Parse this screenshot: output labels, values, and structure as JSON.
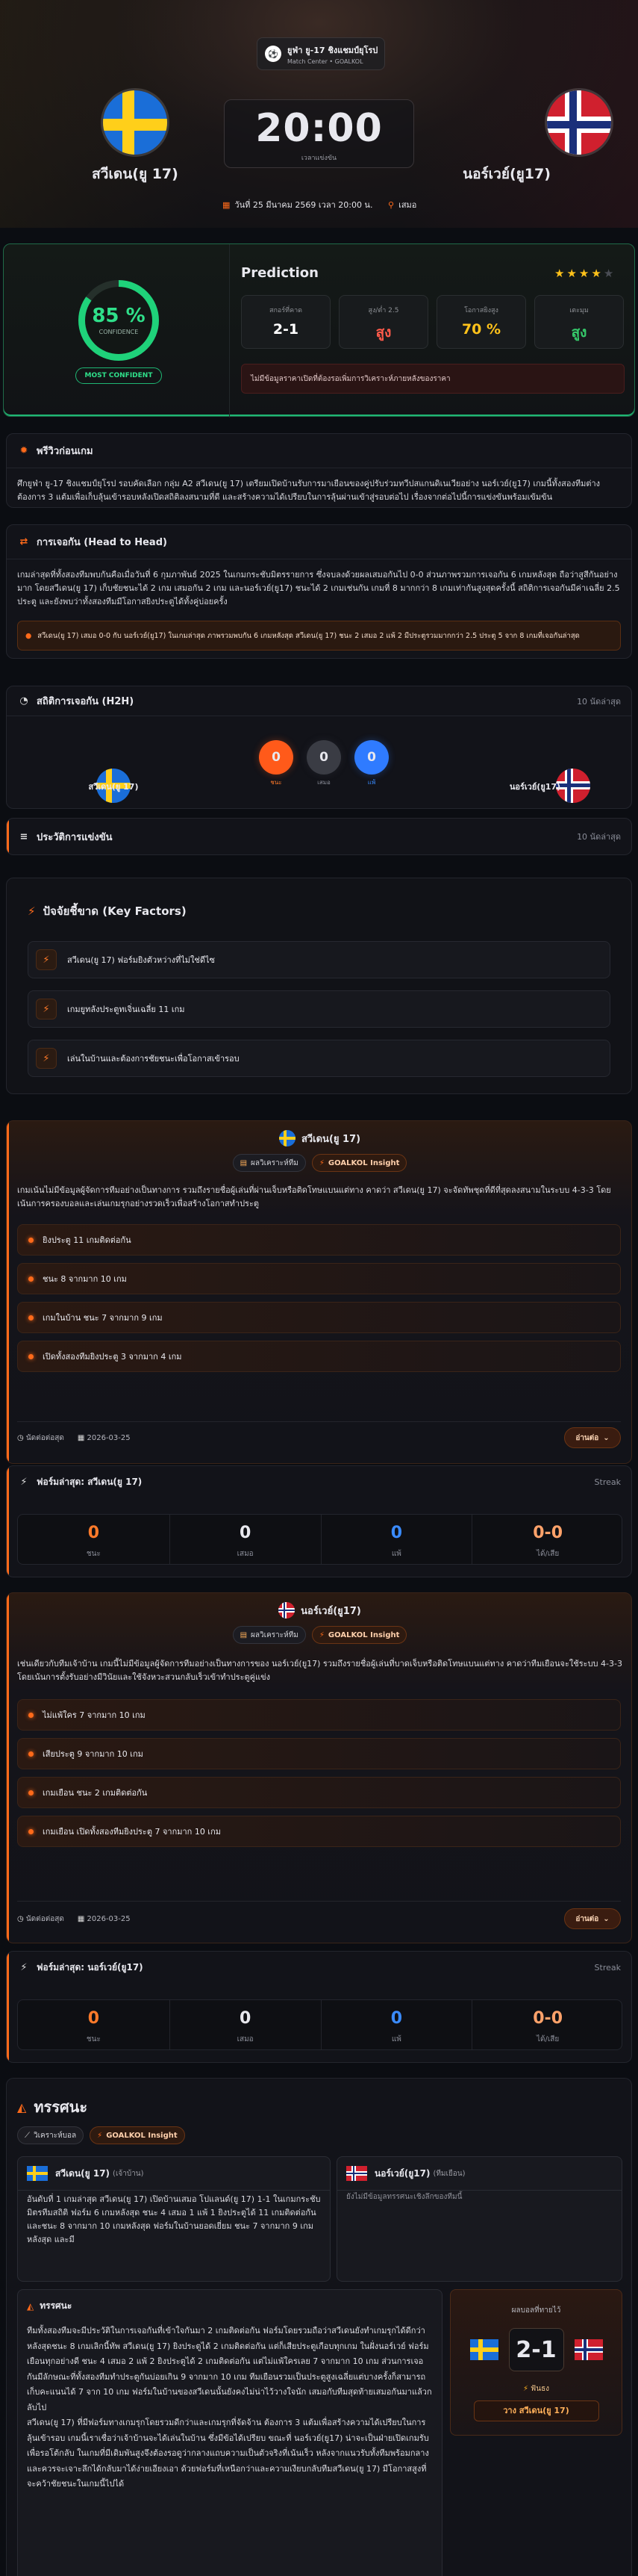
{
  "header": {
    "league": "ยูฟ่า ยู-17 ชิงแชมป์ยุโรป",
    "subtitle": "Match Center • GOALKOL",
    "home_team": "สวีเดน(ยู 17)",
    "away_team": "นอร์เวย์(ยู17)",
    "kickoff_time": "20:00",
    "kickoff_caption": "เวลาแข่งขัน",
    "date": "วันที่ 25 มีนาคม 2569 เวลา 20:00 น.",
    "venue": "เสมอ"
  },
  "prediction": {
    "title": "Prediction",
    "confidence": "85 %",
    "confidence_label": "CONFIDENCE",
    "badge": "MOST CONFIDENT",
    "stars": 4,
    "cells": [
      {
        "label": "สกอร์ที่คาด",
        "value": "2-1",
        "color": "#ffffff"
      },
      {
        "label": "สูง/ต่ำ 2.5",
        "value": "สูง",
        "color": "#ff5a4a"
      },
      {
        "label": "โอกาสยิงสูง",
        "value": "70 %",
        "color": "#ffc21a"
      },
      {
        "label": "เตะมุม",
        "value": "สูง",
        "color": "#35c96a"
      }
    ],
    "note": "ไม่มีข้อมูลราคาเปิดที่ต้องรอเพิ่มการวิเคราะห์ภายหลังของราคา"
  },
  "preview": {
    "title": "พรีวิวก่อนเกม",
    "text": "ศึกยูฟ่า ยู-17 ชิงแชมป์ยุโรป รอบคัดเลือก กลุ่ม A2 สวีเดน(ยู 17) เตรียมเปิดบ้านรับการมาเยือนของคู่ปรับร่วมทวีปสแกนดิเนเวียอย่าง นอร์เวย์(ยู17) เกมนี้ทั้งสองทีมต่างต้องการ 3 แต้มเพื่อเก็บลุ้นเข้ารอบหลังเปิดสถิติลงสนามที่ดี และสร้างความได้เปรียบในการลุ้นผ่านเข้าสู่รอบต่อไป เรื่องจากต่อไปนี้การแข่งขันพร้อมเข้มข้น"
  },
  "h2h_text": {
    "title": "การเจอกัน (Head to Head)",
    "text": "เกมล่าสุดที่ทั้งสองทีมพบกันคือเมื่อวันที่ 6 กุมภาพันธ์ 2025 ในเกมกระชับมิตรรายการ ซึ่งจบลงด้วยผลเสมอกันไป 0-0 ส่วนภาพรวมการเจอกัน 6 เกมหลังสุด ถือว่าสูสีกันอย่างมาก โดยสวีเดน(ยู 17) เก็บชัยชนะได้ 2 เกม เสมอกัน 2 เกม และนอร์เวย์(ยู17) ชนะได้ 2 เกมเช่นกัน เกมที่ 8 มากกว่า 8 เกมเท่ากันสูงสุดครั้งนี้ สถิติการเจอกันมีค่าเฉลี่ย 2.5 ประตู และยังพบว่าทั้งสองทีมมีโอกาสยิงประตูได้ทั้งคู่บ่อยครั้ง",
    "highlight": "สวีเดน(ยู 17) เสมอ 0-0 กับ นอร์เวย์(ยู17) ในเกมล่าสุด ภาพรวมพบกัน 6 เกมหลังสุด สวีเดน(ยู 17) ชนะ 2 เสมอ 2 แพ้ 2 มีประตูรวมมากกว่า 2.5 ประตู 5 จาก 8 เกมที่เจอกันล่าสุด"
  },
  "h2h_stats": {
    "title": "สถิติการเจอกัน (H2H)",
    "right": "10 นัดล่าสุด",
    "home": "สวีเดน(ยู 17)",
    "away": "นอร์เวย์(ยู17)",
    "circles": [
      {
        "value": "0",
        "label": "ชนะ",
        "color": "#ff5a1a"
      },
      {
        "value": "0",
        "label": "เสมอ",
        "color": "#3a3c44"
      },
      {
        "value": "0",
        "label": "แพ้",
        "color": "#2f7bff"
      }
    ]
  },
  "history": {
    "title": "ประวัติการแข่งขัน",
    "right": "10 นัดล่าสุด"
  },
  "key_factors": {
    "title": "ปัจจัยชี้ขาด (Key Factors)",
    "items": [
      "สวีเดน(ยู 17) ฟอร์มยิงตัวหว่างที่ไม่ใช่ดีไซ",
      "เกมยูทลังประตูทเจิ่นเฉลี่ย 11 เกม",
      "เล่นในบ้านและต้องการชัยชนะเพื่อโอกาสเข้ารอบ"
    ]
  },
  "home_insight": {
    "team": "สวีเดน(ยู 17)",
    "tag1": "ผลวิเคราะห์ทีม",
    "tag2": "GOALKOL Insight",
    "text": "เกมเน้นไม่มีข้อมูลผู้จัดการทีมอย่างเป็นทางการ รวมถึงรายชื่อผู้เล่นที่ผ่านเจ็บหรือติดโทษแบนแต่ทาง คาดว่า สวีเดน(ยู 17) จะจัดทัพชุดที่ดีที่สุดลงสนามในระบบ 4-3-3 โดยเน้นการครองบอลและเล่นเกมรุกอย่างรวดเร็วเพื่อสร้างโอกาสทำประตู",
    "bullets": [
      "ยิงประตู 11 เกมติดต่อกัน",
      "ชนะ 8 จากมาก 10 เกม",
      "เกมในบ้าน ชนะ 7 จากมาก 9 เกม",
      "เปิดทั้งสองทีมยิงประตู 3 จากมาก 4 เกม"
    ],
    "meta1": "นัดต่อต่อสุด",
    "meta2": "2026-03-25",
    "more": "อ่านต่อ"
  },
  "home_form": {
    "title": "ฟอร์มล่าสุด: สวีเดน(ยู 17)",
    "right": "Streak",
    "cells": [
      {
        "value": "0",
        "label": "ชนะ",
        "color": "#ff7a2a"
      },
      {
        "value": "0",
        "label": "เสมอ",
        "color": "#e8e8ee"
      },
      {
        "value": "0",
        "label": "แพ้",
        "color": "#3a8bff"
      },
      {
        "value": "0-0",
        "label": "ได้/เสีย",
        "color": "#ffa26a"
      }
    ]
  },
  "away_insight": {
    "team": "นอร์เวย์(ยู17)",
    "tag1": "ผลวิเคราะห์ทีม",
    "tag2": "GOALKOL Insight",
    "text": "เช่นเดียวกับทีมเจ้าบ้าน เกมนี้ไม่มีข้อมูลผู้จัดการทีมอย่างเป็นทางการของ นอร์เวย์(ยู17) รวมถึงรายชื่อผู้เล่นที่บาดเจ็บหรือติดโทษแบนแต่ทาง คาดว่าทีมเยือนจะใช้ระบบ 4-3-3 โดยเน้นการตั้งรับอย่างมีวินัยและใช้จังหวะสวนกลับเร็วเข้าทำประตูคู่แข่ง",
    "bullets": [
      "ไม่แพ้ใคร 7 จากมาก 10 เกม",
      "เสียประตู 9 จากมาก 10 เกม",
      "เกมเยือน ชนะ 2 เกมติดต่อกัน",
      "เกมเยือน เปิดทั้งสองทีมยิงประตู 7 จากมาก 10 เกม"
    ],
    "meta1": "นัดต่อต่อสุด",
    "meta2": "2026-03-25",
    "more": "อ่านต่อ"
  },
  "away_form": {
    "title": "ฟอร์มล่าสุด: นอร์เวย์(ยู17)",
    "right": "Streak",
    "cells": [
      {
        "value": "0",
        "label": "ชนะ",
        "color": "#ff7a2a"
      },
      {
        "value": "0",
        "label": "เสมอ",
        "color": "#e8e8ee"
      },
      {
        "value": "0",
        "label": "แพ้",
        "color": "#3a8bff"
      },
      {
        "value": "0-0",
        "label": "ได้/เสีย",
        "color": "#ffa26a"
      }
    ]
  },
  "analysis": {
    "title": "ทรรศนะ",
    "tag1": "วิเคราะห์บอล",
    "tag2": "GOALKOL Insight",
    "home_card_title": "สวีเดน(ยู 17)",
    "home_card_sub": "(เจ้าบ้าน)",
    "home_card_text": "อันดับที่ 1 เกมล่าสุด สวีเดน(ยู 17) เปิดบ้านเสมอ โปแลนด์(ยู 17) 1-1 ในเกมกระชับมิตรทีมสถิติ ฟอร์ม 6 เกมหลังสุด ชนะ 4 เสมอ 1 แพ้ 1 ยิงประตูได้ 11 เกมติดต่อกัน และชนะ 8 จากมาก 10 เกมหลังสุด ฟอร์มในบ้านยอดเยี่ยม ชนะ 7 จากมาก 9 เกมหลังสุด และมี",
    "away_card_title": "นอร์เวย์(ยู17)",
    "away_card_sub": "(ทีมเยือน)",
    "away_card_text": "ยังไม่มีข้อมูลทรรศนะเชิงลึกของทีมนี้",
    "verdict_title": "ทรรศนะ",
    "verdict_text": "ทีมทั้งสองทีมจะมีประวัติในการเจอกันที่เข้าใจกันมา 2 เกมติดต่อกัน ฟอร์มโดยรวมถือว่าสวีเดนยังทำเกมรุกได้ดีกว่าหลังสุดชนะ 8 เกมเลิกนี้ทัพ สวีเดน(ยู 17) ยิงประตูได้ 2 เกมติดต่อกัน แต่ก็เสียประตูเกือบทุกเกม ในฝั่งนอร์เวย์ ฟอร์มเยือนทุกอย่างดี ชนะ 4 เสมอ 2 แพ้ 2 ยิงประตูได้ 2 เกมติดต่อกัน แต่ไม่แพ้ใครเลย 7 จากมาก 10 เกม ส่วนการเจอกันมีลักษณะที่ทั้งสองทีมทำประตูกันบ่อยเกิน 9 จากมาก 10 เกม ทีมเยือนรวมเป็นประตูสูงเฉลี่ยแต่บางครั้งก็สามารถเก็บคะแนนได้ 7 จาก 10 เกม ฟอร์มในบ้านของสวีเดนนั้นยังคงไม่น่าไว้วางใจนัก เสมอกับทีมสุดท้ายเสมอกันมาแล้วกลับไป\nสวีเดน(ยู 17) ที่มีฟอร์มทางเกมรุกโดยรวมดีกว่าและเกมรุกที่จัดจ้าน ต้องการ 3 แต้มเพื่อสร้างความได้เปรียบในการลุ้นเข้ารอบ เกมนี้เราเชื่อว่าเจ้าบ้านจะได้เล่นในบ้าน ซึ่งมีข้อได้เปรียบ ขณะที่ นอร์เวย์(ยู17) น่าจะเป็นฝ่ายเปิดเกมรับเพื่อรอโต้กลับ ในเกมที่มีเดิมพันสูงจึงต้องรอดูว่ากลางแถบความเป็นตัวจริงที่เน้นเร็ว หลังจากแนวรับทั้งทีมพร้อมกลางและควรจะเจาะลึกได้กลับมาได้ง่ายเอียงเอา ด้วยฟอร์มที่เหนือกว่าและความเงียบกลับทีมสวีเดน(ยู 17) มีโอกาสสูงที่จะคว้าชัยชนะในเกมนี้ไปได้",
    "score_title": "ผลบอลที่ทายไว้",
    "score": "2-1",
    "score_tip": "ฟันธง",
    "score_pick": "วาง สวีเดน(ยู 17)"
  },
  "colors": {
    "accent": "#ff6a1a",
    "bg": "#0b0d12",
    "panel": "#121319"
  }
}
